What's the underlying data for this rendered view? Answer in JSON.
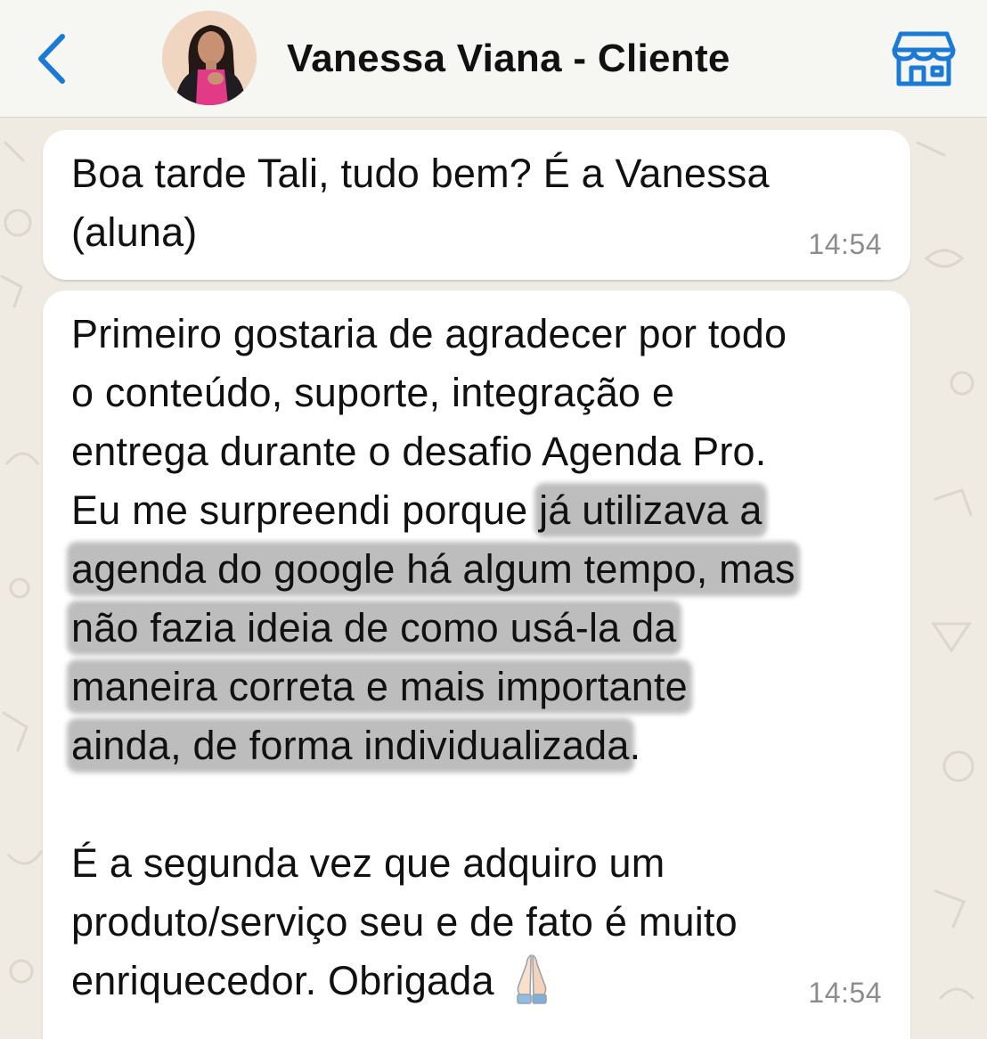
{
  "header": {
    "back_icon": "chevron-left-icon",
    "contact_name": "Vanessa Viana - Cliente",
    "avatar_icon": "contact-avatar",
    "store_icon": "storefront-icon",
    "accent_color": "#1a7ad6"
  },
  "messages": [
    {
      "lines": [
        "Boa tarde Tali, tudo bem? É a Vanessa",
        "(aluna)"
      ],
      "time": "14:54"
    },
    {
      "lines": [
        "Primeiro gostaria de agradecer por todo",
        "o conteúdo, suporte, integração e",
        "entrega durante o desafio Agenda Pro.",
        "Eu me surpreendi porque ",
        "já utilizava a",
        "agenda do google há algum tempo, mas",
        "não fazia ideia de como usá-la da",
        "maneira correta e mais importante",
        "ainda, de forma individualizada",
        ".",
        "",
        "É a segunda vez que adquiro um",
        "produto/serviço seu e de fato é muito",
        "enriquecedor. Obrigada"
      ],
      "emoji": "folded-hands-icon",
      "highlight_color": "#bdbdbd",
      "time": "14:54"
    }
  ]
}
